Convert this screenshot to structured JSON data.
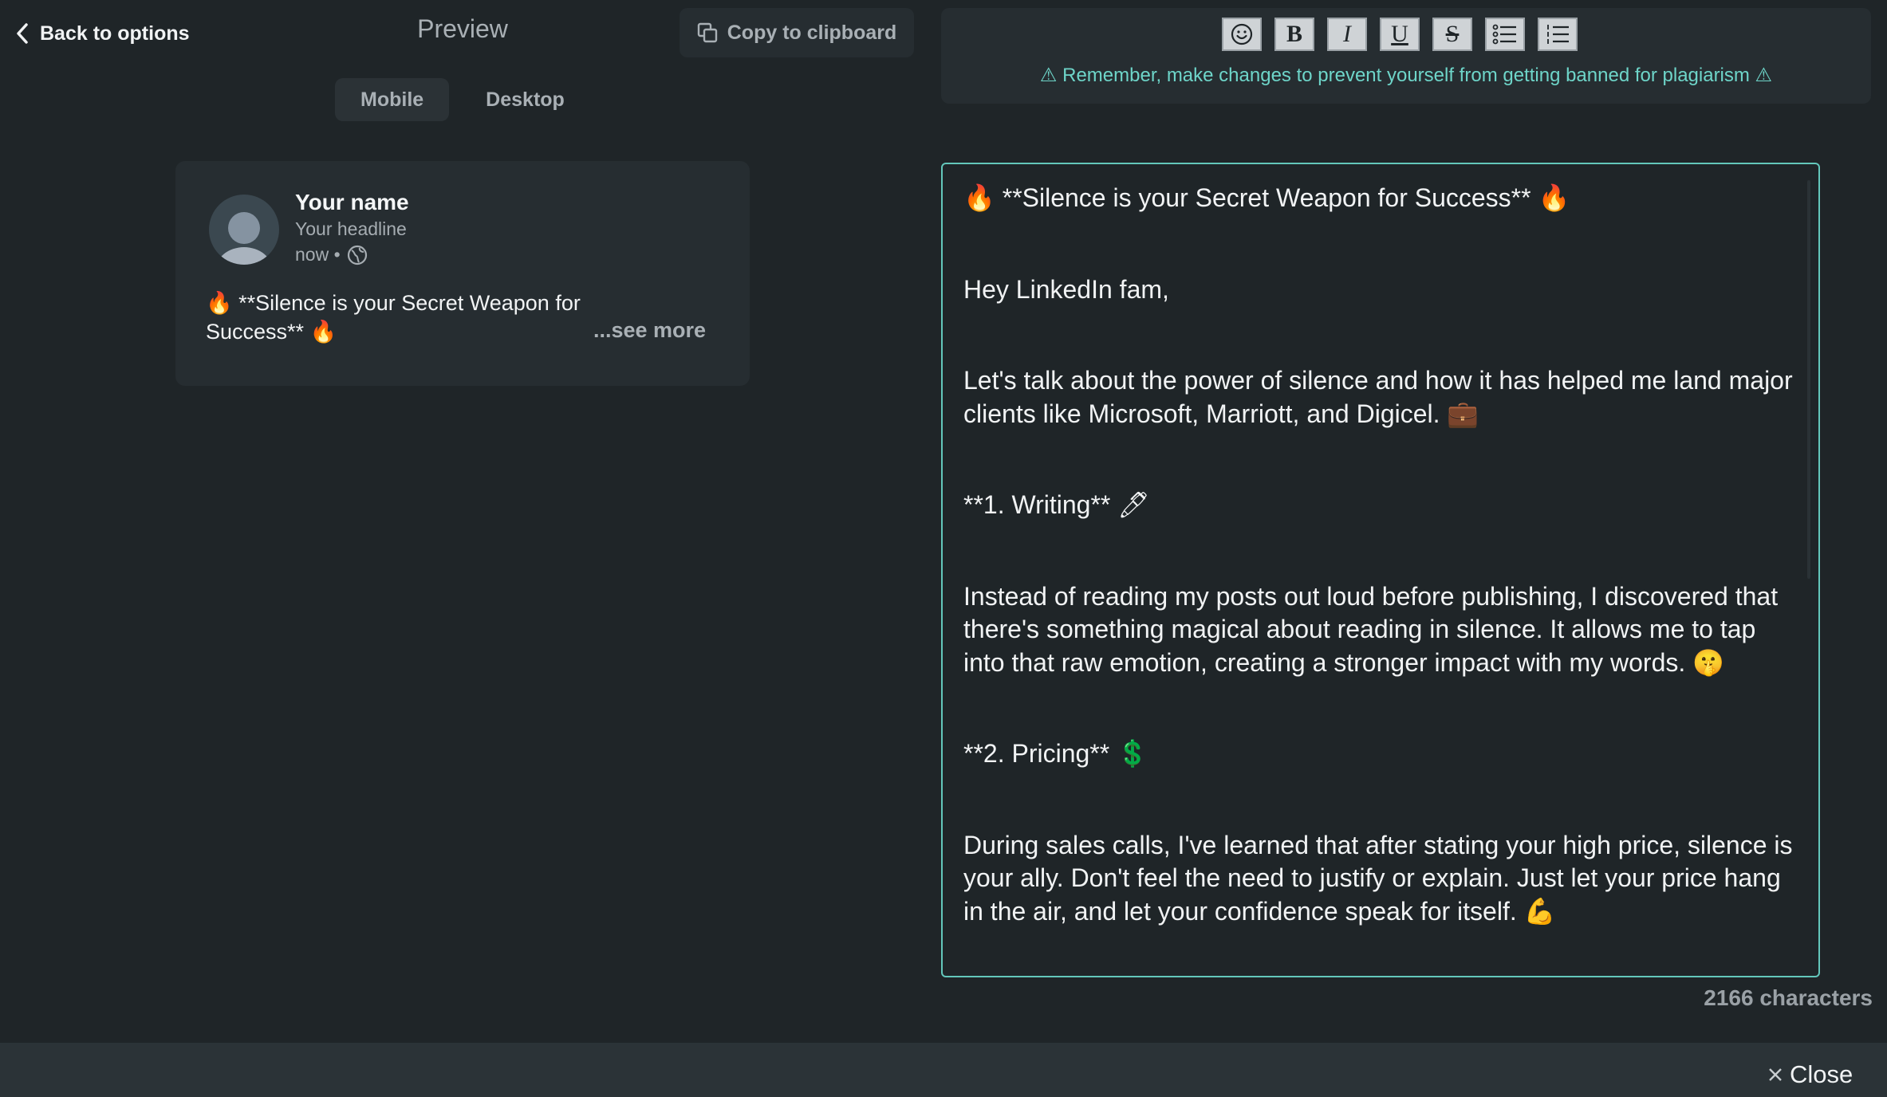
{
  "header": {
    "back_label": "Back to options",
    "preview_title": "Preview",
    "copy_label": "Copy to clipboard"
  },
  "tabs": [
    {
      "label": "Mobile",
      "active": true
    },
    {
      "label": "Desktop",
      "active": false
    }
  ],
  "post": {
    "name": "Your name",
    "headline": "Your headline",
    "time": "now •",
    "excerpt": "🔥 **Silence is your Secret Weapon for Success** 🔥",
    "see_more": "...see more"
  },
  "toolbar": {
    "buttons": [
      "emoji-icon",
      "bold-icon",
      "italic-icon",
      "underline-icon",
      "strikethrough-icon",
      "bullet-list-icon",
      "numbered-list-icon"
    ],
    "bold_glyph": "B",
    "italic_glyph": "I",
    "underline_glyph": "U",
    "strike_glyph": "S",
    "warning": "⚠ Remember, make changes to prevent yourself from getting banned for plagiarism ⚠"
  },
  "editor": {
    "lines": [
      "🔥 **Silence is your Secret Weapon for Success** 🔥",
      "Hey LinkedIn fam,",
      "Let's talk about the power of silence and how it has helped me land major clients like Microsoft, Marriott, and Digicel. 💼",
      "**1. Writing** 🖊",
      "Instead of reading my posts out loud before publishing, I discovered that there's something magical about reading in silence. It allows me to tap into that raw emotion, creating a stronger impact with my words. 🤫",
      "**2. Pricing** 💲",
      "During sales calls, I've learned that after stating your high price, silence is your ally. Don't feel the need to justify or explain. Just let your price hang in the air, and let your confidence speak for itself. 💪"
    ]
  },
  "char_count": "2166 characters",
  "close_label": "Close",
  "colors": {
    "background": "#1f2528",
    "panel": "#262d31",
    "accent": "#63c7bb",
    "warning_text": "#6ed5c9"
  }
}
